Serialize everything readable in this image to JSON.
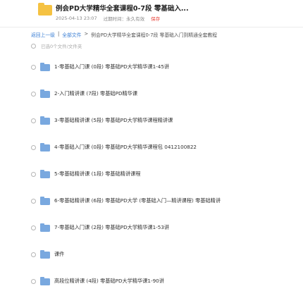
{
  "share": {
    "title": "例会PD大学精华全套课程0-7段 零基础入...",
    "date": "2025-04-13 23:07",
    "expiry": "过期时间：永久有效",
    "save_label": "保存"
  },
  "breadcrumb": {
    "back": "返回上一级",
    "sep": "|",
    "root": "全部文件",
    "arrow": ">",
    "current": "例会PD大学精华全套课程0-7段 零基础入门到精通全套教程"
  },
  "list_header": {
    "select_text": "已选0个文件/文件夹"
  },
  "files": [
    {
      "name": "1-零基础入门课 (0段) 零基础PD大学精华课1-45讲"
    },
    {
      "name": "2-入门精讲课 (7段) 零基础PD精华课"
    },
    {
      "name": "3-零基础精讲课 (5段) 零基础PD大学精华课程精讲课"
    },
    {
      "name": "4-零基础入门课 (0段) 零基础PD大学精华课程包 0412100822"
    },
    {
      "name": "5-零基础精讲课 (1段) 零基础精讲课程"
    },
    {
      "name": "6-零基础精讲课 (6段) 零基础PD大学 (零基础入门—精讲课程) 零基础精讲"
    },
    {
      "name": "7-零基础入门课 (2段) 零基础PD大学精华课1-53讲"
    },
    {
      "name": "课件"
    },
    {
      "name": "高段位精讲课 (4段) 零基础PD大学精华课1-90讲"
    }
  ],
  "icons": {
    "share_folder": "folder-icon",
    "file_folder": "folder-icon",
    "checkbox": "circle-checkbox"
  },
  "colors": {
    "accent": "#3b7fd4",
    "folder_yellow": "#f5c242",
    "folder_blue": "#79a8df",
    "save_red": "#e8453c"
  }
}
